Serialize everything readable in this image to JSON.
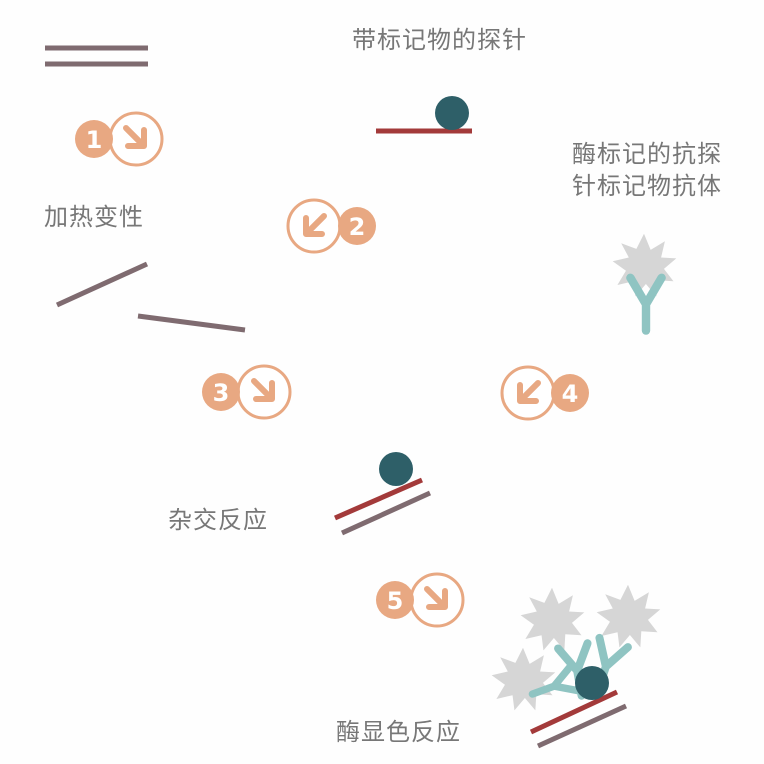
{
  "labels": {
    "probe": "带标记物的探针",
    "enzyme_line1": "酶标记的抗探",
    "enzyme_line2": "针标记物抗体",
    "denature": "加热变性",
    "hybridize": "杂交反应",
    "color": "酶显色反应"
  },
  "steps": [
    {
      "number": "1",
      "arrow": "down-right"
    },
    {
      "number": "2",
      "arrow": "down-left"
    },
    {
      "number": "3",
      "arrow": "down-right"
    },
    {
      "number": "4",
      "arrow": "down-left"
    },
    {
      "number": "5",
      "arrow": "down-right"
    }
  ],
  "colors": {
    "step": "#e8a882",
    "dna_strand": "#7f6b70",
    "probe_strand": "#a33a3a",
    "label_ball": "#2e5f68",
    "antibody": "#8fc4c2",
    "enzyme": "#d6d6d6",
    "text": "#777777"
  }
}
